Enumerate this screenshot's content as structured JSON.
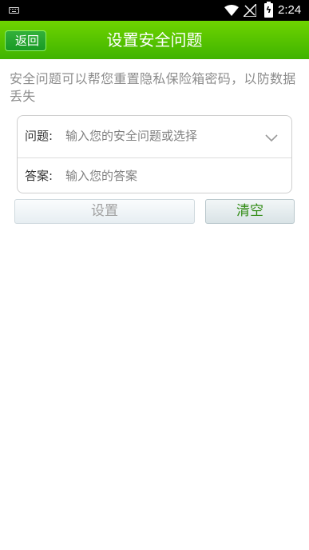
{
  "status_bar": {
    "time": "2:24",
    "icons": [
      "keyboard-icon",
      "wifi-icon",
      "signal-icon",
      "battery-charging-icon"
    ]
  },
  "header": {
    "back_label": "返回",
    "title": "设置安全问题"
  },
  "description": "安全问题可以帮您重置隐私保险箱密码，以防数据丢失",
  "form": {
    "question_label": "问题:",
    "question_placeholder": "输入您的安全问题或选择",
    "answer_label": "答案:",
    "answer_placeholder": "输入您的答案"
  },
  "buttons": {
    "set_label": "设置",
    "clear_label": "清空"
  },
  "colors": {
    "header_green": "#4cc000",
    "clear_text": "#2f8a12",
    "description_text": "#8c8c8c"
  }
}
